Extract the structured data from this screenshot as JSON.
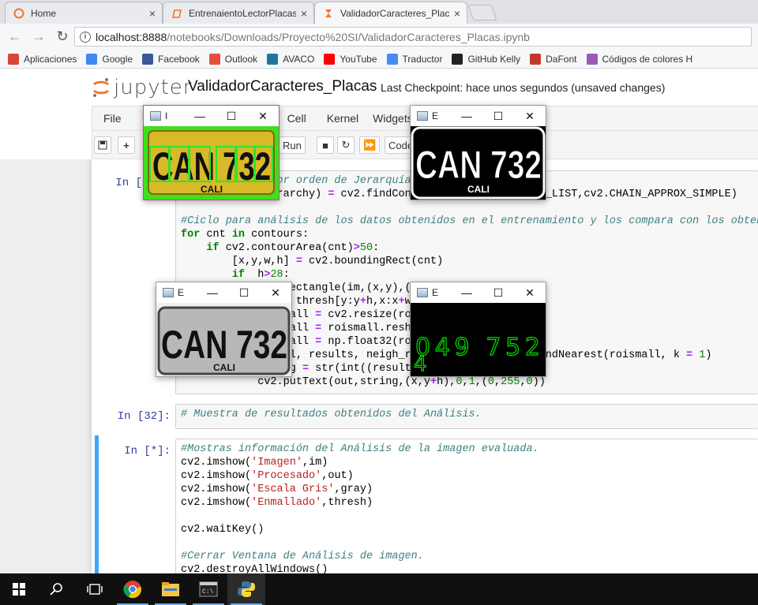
{
  "browser": {
    "tabs": [
      {
        "label": "Home",
        "close": "×"
      },
      {
        "label": "EntrenaientoLectorPlacas",
        "close": "×"
      },
      {
        "label": "ValidadorCaracteres_Plac",
        "close": "×"
      }
    ],
    "url_host": "localhost:8888",
    "url_path": "/notebooks/Downloads/Proyecto%20SI/ValidadorCaracteres_Placas.ipynb",
    "bookmarks": [
      {
        "label": "Aplicaciones",
        "color": "#db4437"
      },
      {
        "label": "Google",
        "color": "#4285f4"
      },
      {
        "label": "Facebook",
        "color": "#3b5998"
      },
      {
        "label": "Outlook",
        "color": "#e74c3c"
      },
      {
        "label": "AVACO",
        "color": "#21759b"
      },
      {
        "label": "YouTube",
        "color": "#ff0000"
      },
      {
        "label": "Traductor",
        "color": "#4a8af4"
      },
      {
        "label": "GitHub Kelly",
        "color": "#222222"
      },
      {
        "label": "DaFont",
        "color": "#c0392b"
      },
      {
        "label": "Códigos de colores H",
        "color": "#9b59b6"
      }
    ]
  },
  "jupyter": {
    "logo_text": "jupyter",
    "notebook_name": "ValidadorCaracteres_Placas",
    "checkpoint": "Last Checkpoint: hace unos segundos  (unsaved changes)",
    "menu": [
      "File",
      "Cell",
      "Kernel",
      "Widgets"
    ],
    "toolbar": {
      "run": "Run",
      "cell_type": "Code"
    }
  },
  "cells": [
    {
      "prompt": "In [",
      "lines": [
        "#Ordenamiento por orden de Jerarquía de los contornos",
        "(_,contours,hierarchy) = cv2.findContours(thresh,cv2.RETR_LIST,cv2.CHAIN_APPROX_SIMPLE)",
        "",
        "#Ciclo para análisis de los datos obtenidos en el entrenamiento y los compara con los obtenidos",
        "for cnt in contours:",
        "    if cv2.contourArea(cnt)>50:",
        "        [x,y,w,h] = cv2.boundingRect(cnt)",
        "        if  h>28:",
        "            cv2.rectangle(im,(x,y),(x+w,y+h),(0,255,0),2)",
        "            roi = thresh[y:y+h,x:x+w]",
        "            roismall = cv2.resize(roi,(10,10))",
        "            roismall = roismall.reshape((1,100))",
        "            roismall = np.float32(roismall)",
        "            retval, results, neigh_resp, dists = model.findNearest(roismall, k = 1)",
        "            string = str(int((results[0][0])))",
        "            cv2.putText(out,string,(x,y+h),0,1,(0,255,0))"
      ]
    },
    {
      "prompt": "In [32]:",
      "lines": [
        "# Muestra de resultados obtenidos del Análisis."
      ]
    },
    {
      "prompt": "In [*]:",
      "lines": [
        "#Mostras información del Análisis de la imagen evaluada.",
        "cv2.imshow('Imagen',im)",
        "cv2.imshow('Procesado',out)",
        "cv2.imshow('Escala Gris',gray)",
        "cv2.imshow('Enmallado',thresh)",
        "",
        "cv2.waitKey()",
        "",
        "#Cerrar Ventana de Análisis de imagen.",
        "cv2.destroyAllWindows()"
      ]
    }
  ],
  "windows": {
    "plate_text": "CAN 732",
    "plate_city": "CALI",
    "w1": {
      "title": "I",
      "ctrls": [
        "—",
        "☐",
        "✕"
      ]
    },
    "w2": {
      "title": "E",
      "ctrls": [
        "—",
        "☐",
        "✕"
      ]
    },
    "w3": {
      "title": "E",
      "ctrls": [
        "—",
        "☐",
        "✕"
      ]
    },
    "w4": {
      "title": "E",
      "ctrls": [
        "—",
        "☐",
        "✕"
      ]
    },
    "digits": "049 752",
    "digit_extra": "4"
  },
  "taskbar": [
    "windows-start",
    "search",
    "task-view",
    "chrome",
    "file-explorer",
    "terminal",
    "python"
  ]
}
